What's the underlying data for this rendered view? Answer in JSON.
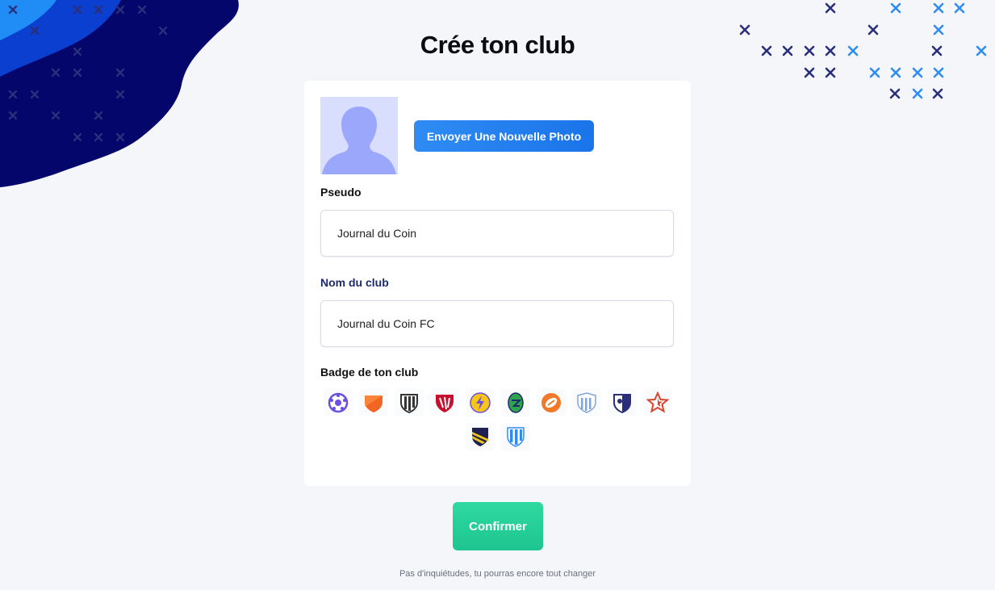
{
  "header": {
    "title": "Crée ton club"
  },
  "profile": {
    "upload_label": "Envoyer Une Nouvelle Photo"
  },
  "form": {
    "pseudo_label": "Pseudo",
    "pseudo_value": "Journal du Coin",
    "club_label": "Nom du club",
    "club_value": "Journal du Coin FC",
    "badge_label": "Badge de ton club"
  },
  "badges": [
    {
      "icon": "badge-ball-purple-icon",
      "color": "#6c4fe0"
    },
    {
      "icon": "badge-shield-orange-icon",
      "color": "#f26522"
    },
    {
      "icon": "badge-shield-striped-black-icon",
      "color": "#333333"
    },
    {
      "icon": "badge-shield-red-icon",
      "color": "#c8102e"
    },
    {
      "icon": "badge-lightning-yellow-icon",
      "color": "#f5c518"
    },
    {
      "icon": "badge-green-egg-icon",
      "color": "#2ea44f"
    },
    {
      "icon": "badge-orange-ball-icon",
      "color": "#f07a2a"
    },
    {
      "icon": "badge-shield-blue-stripes-icon",
      "color": "#7fa6d8"
    },
    {
      "icon": "badge-shield-navy-icon",
      "color": "#2b2f7a"
    },
    {
      "icon": "badge-star-red-icon",
      "color": "#d9442b"
    },
    {
      "icon": "badge-shield-navy-yellow-icon",
      "color": "#f0c419"
    },
    {
      "icon": "badge-shield-blue-white-icon",
      "color": "#2f8cf3"
    }
  ],
  "actions": {
    "confirm_label": "Confirmer"
  },
  "footer": {
    "note": "Pas d'inquiétudes, tu pourras encore tout changer"
  },
  "colors": {
    "primary": "#1a74ea",
    "confirm": "#22cc93",
    "navy": "#0a0a6b"
  }
}
